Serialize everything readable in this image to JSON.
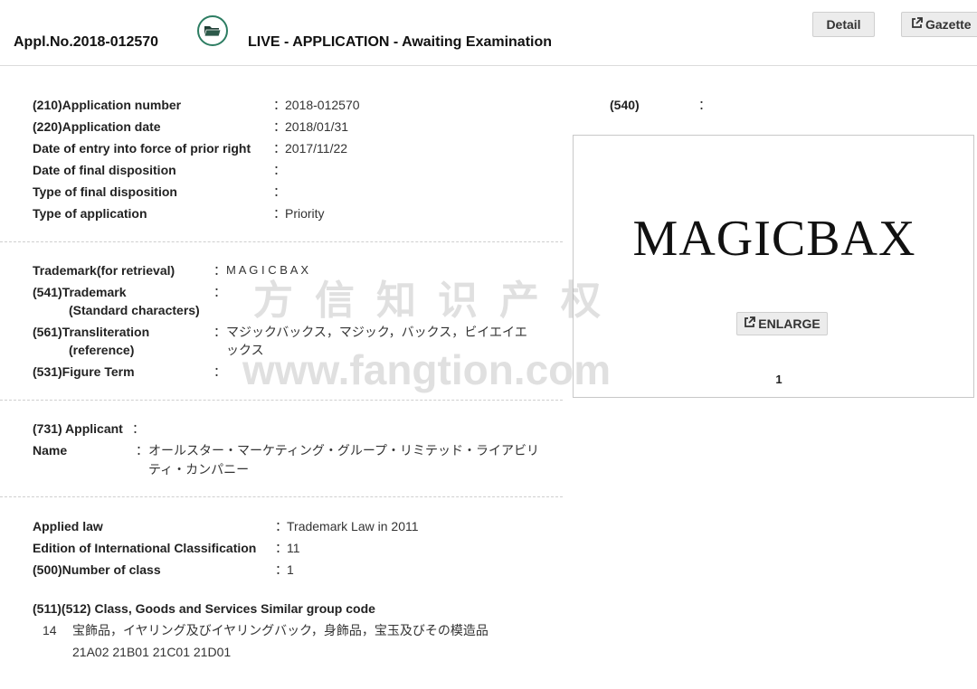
{
  "header": {
    "appl_no": "Appl.No.2018-012570",
    "status": "LIVE - APPLICATION - Awaiting Examination",
    "detail_label": "Detail",
    "gazette_label": "Gazette"
  },
  "section1": {
    "rows": [
      {
        "label": "(210)Application number",
        "value": "2018-012570"
      },
      {
        "label": "(220)Application date",
        "value": "2018/01/31"
      },
      {
        "label": "Date of entry into force of prior right",
        "value": "2017/11/22"
      },
      {
        "label": "Date of final disposition",
        "value": ""
      },
      {
        "label": "Type of final disposition",
        "value": ""
      },
      {
        "label": "Type of application",
        "value": "Priority"
      }
    ]
  },
  "section2": {
    "retrieval_label": "Trademark(for retrieval)",
    "retrieval_value": "M A G I C B A X",
    "tm_label_1": "(541)Trademark",
    "tm_label_2": "(Standard characters)",
    "translit_label_1": "(561)Transliteration",
    "translit_label_2": "(reference)",
    "translit_value_1": "マジックバックス，マジック，バックス，ビイエイエ",
    "translit_value_2": "ックス",
    "figure_label": "(531)Figure Term"
  },
  "section3": {
    "applicant_label": "(731) Applicant",
    "name_label": "Name",
    "name_value_1": "オールスター・マーケティング・グループ・リミテッド・ライアビリ",
    "name_value_2": "ティ・カンパニー"
  },
  "section4": {
    "rows": [
      {
        "label": "Applied law",
        "value": "Trademark Law in 2011"
      },
      {
        "label": "Edition of International Classification",
        "value": "11"
      },
      {
        "label": "(500)Number of class",
        "value": "1"
      }
    ],
    "goods_header": "(511)(512) Class, Goods and Services Similar group code",
    "class_no": "14",
    "goods": "宝飾品，イヤリング及びイヤリングバック，身飾品，宝玉及びその模造品",
    "codes": "21A02 21B01 21C01 21D01"
  },
  "image_panel": {
    "label": "(540)",
    "mark_text": "MAGICBAX",
    "enlarge_label": "ENLARGE",
    "page_number": "1"
  },
  "watermark": {
    "line1": "方信知识产权",
    "line2": "www.fangtion.com"
  },
  "colon": "："
}
